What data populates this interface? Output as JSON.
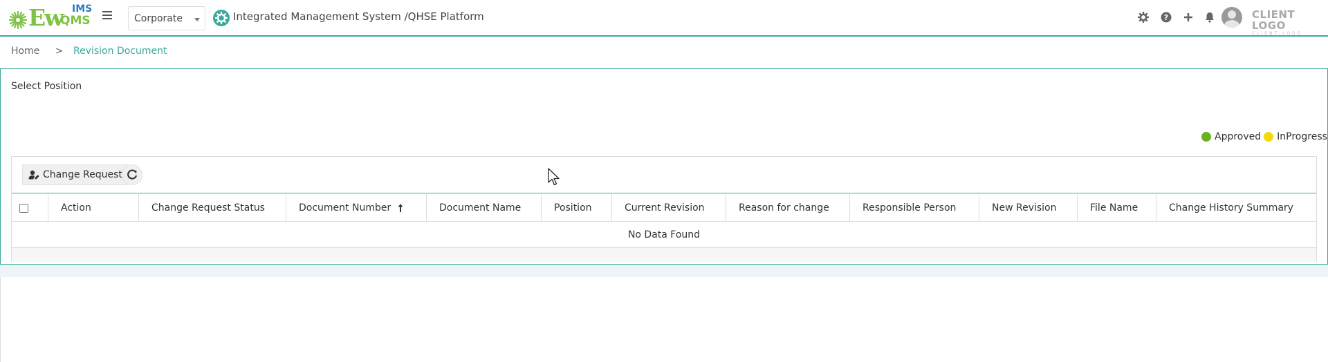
{
  "header": {
    "logo": {
      "ew": "Ew",
      "ims": "IMS",
      "qms": "QMS"
    },
    "company_select": {
      "value": "Corporate"
    },
    "platform_title": "Integrated Management System /QHSE Platform",
    "client_logo": {
      "line1": "CLIENT LOGO",
      "line2": "CLIENT LOGO"
    },
    "icons": [
      "gear-icon",
      "help-icon",
      "plus-icon",
      "bell-icon",
      "user-avatar"
    ]
  },
  "breadcrumb": {
    "home": "Home",
    "separator": ">",
    "current": "Revision Document"
  },
  "main": {
    "select_position_label": "Select Position",
    "legend": [
      {
        "label": "Approved",
        "color": "#6ab023"
      },
      {
        "label": "InProgress",
        "color": "#f5d90a"
      }
    ],
    "toolbar": {
      "change_request_label": "Change Request"
    },
    "table": {
      "columns": [
        "Action",
        "Change Request Status",
        "Document Number",
        "Document Name",
        "Position",
        "Current Revision",
        "Reason for change",
        "Responsible Person",
        "New Revision",
        "File Name",
        "Change History Summary"
      ],
      "sorted_column": "Document Number",
      "empty_message": "No Data Found"
    }
  },
  "colors": {
    "accent": "#3aa99a",
    "logo_green": "#7dc242",
    "logo_blue": "#2b7bbf"
  }
}
